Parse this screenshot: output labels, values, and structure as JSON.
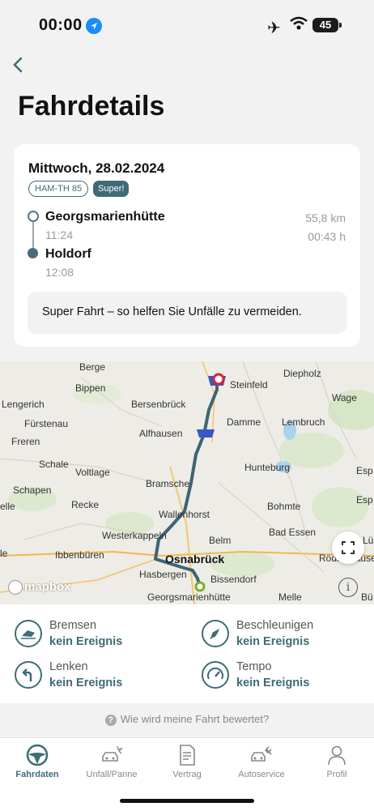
{
  "status": {
    "time": "00:00",
    "battery": "45"
  },
  "header": {
    "title": "Fahrdetails"
  },
  "trip": {
    "date": "Mittwoch, 28.02.2024",
    "plate": "HAM-TH 85",
    "rating_badge": "Super!",
    "start_place": "Georgsmarienhütte",
    "start_time": "11:24",
    "end_place": "Holdorf",
    "end_time": "12:08",
    "distance": "55,8 km",
    "duration": "00:43 h",
    "hint": "Super Fahrt – so helfen Sie Unfälle zu vermeiden."
  },
  "map": {
    "logo": "mapbox",
    "info": "i",
    "labels": {
      "berge": "Berge",
      "bippen": "Bippen",
      "lengerich": "Lengerich",
      "bersenbrueck": "Bersenbrück",
      "steinfeld": "Steinfeld",
      "diepholz": "Diepholz",
      "wagenfeld": "Wage",
      "fuerstenau": "Fürstenau",
      "alfhausen": "Alfhausen",
      "damme": "Damme",
      "lembruch": "Lembruch",
      "freren": "Freren",
      "schale": "Schale",
      "voltlage": "Voltlage",
      "hunteburg": "Hunteburg",
      "bramsche": "Bramsche",
      "schapen": "Schapen",
      "recke": "Recke",
      "wallenhorst": "Wallenhorst",
      "bohmte": "Bohmte",
      "espelkamp": "Esp",
      "ubbe": "elle",
      "westerkappeln": "Westerkappeln",
      "belm": "Belm",
      "badessen": "Bad Essen",
      "ibbenbueren": "Ibbenbüren",
      "osnabrueck": "Osnabrück",
      "hasbergen": "Hasbergen",
      "bissendorf": "Bissendorf",
      "roedinghausen": "Rödinghausen",
      "georgsmarienhuette": "Georgsmarienhütte",
      "melle": "Melle",
      "bue": "Bü",
      "luebbecke": "Lü",
      "ue": "le",
      "espe2": "Esp"
    }
  },
  "events": {
    "brake_label": "Bremsen",
    "brake_value": "kein Ereignis",
    "accel_label": "Beschleunigen",
    "accel_value": "kein Ereignis",
    "steer_label": "Lenken",
    "steer_value": "kein Ereignis",
    "speed_label": "Tempo",
    "speed_value": "kein Ereignis"
  },
  "rating_link": "Wie wird meine Fahrt bewertet?",
  "tabs": [
    {
      "label": "Fahrdaten",
      "icon": "steering-wheel-icon"
    },
    {
      "label": "Unfall/Panne",
      "icon": "car-crash-icon"
    },
    {
      "label": "Vertrag",
      "icon": "document-icon"
    },
    {
      "label": "Autoservice",
      "icon": "car-service-icon"
    },
    {
      "label": "Profil",
      "icon": "person-icon"
    }
  ],
  "colors": {
    "accent": "#3f6b78",
    "route": "#3d6472",
    "start_marker": "#7bb02a",
    "end_marker": "#d9233a"
  }
}
